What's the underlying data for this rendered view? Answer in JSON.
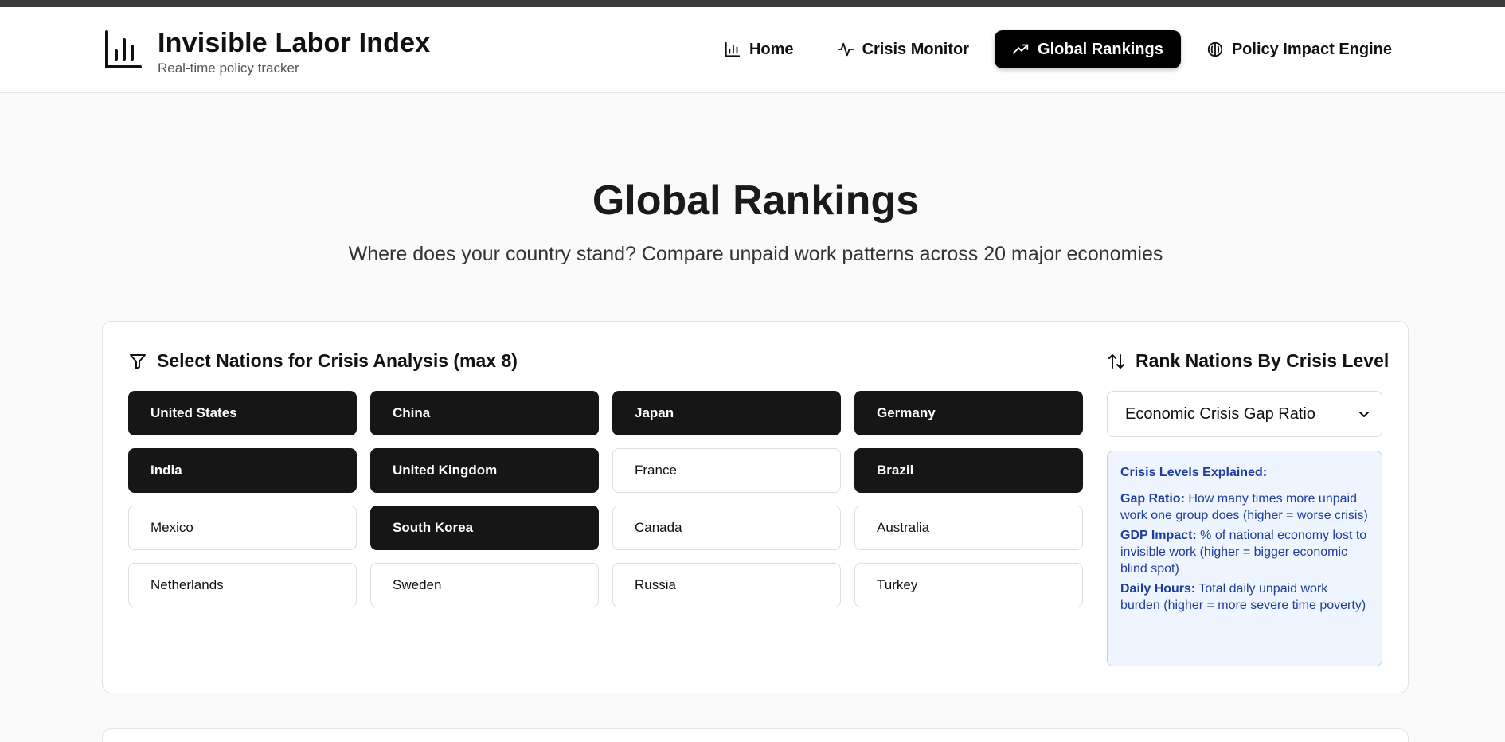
{
  "brand": {
    "title": "Invisible Labor Index",
    "subtitle": "Real-time policy tracker",
    "icon": "bar-chart-icon"
  },
  "nav": [
    {
      "label": "Home",
      "icon": "bar-chart-icon",
      "active": false
    },
    {
      "label": "Crisis Monitor",
      "icon": "activity-icon",
      "active": false
    },
    {
      "label": "Global Rankings",
      "icon": "trending-up-icon",
      "active": true
    },
    {
      "label": "Policy Impact Engine",
      "icon": "brain-icon",
      "active": false
    }
  ],
  "page": {
    "title": "Global Rankings",
    "subtitle": "Where does your country stand? Compare unpaid work patterns across 20 major economies"
  },
  "selection": {
    "heading": "Select Nations for Crisis Analysis (max 8)",
    "nations": [
      {
        "name": "United States",
        "selected": true
      },
      {
        "name": "China",
        "selected": true
      },
      {
        "name": "Japan",
        "selected": true
      },
      {
        "name": "Germany",
        "selected": true
      },
      {
        "name": "India",
        "selected": true
      },
      {
        "name": "United Kingdom",
        "selected": true
      },
      {
        "name": "France",
        "selected": false
      },
      {
        "name": "Brazil",
        "selected": true
      },
      {
        "name": "Mexico",
        "selected": false
      },
      {
        "name": "South Korea",
        "selected": true
      },
      {
        "name": "Canada",
        "selected": false
      },
      {
        "name": "Australia",
        "selected": false
      },
      {
        "name": "Netherlands",
        "selected": false
      },
      {
        "name": "Sweden",
        "selected": false
      },
      {
        "name": "Russia",
        "selected": false
      },
      {
        "name": "Turkey",
        "selected": false
      }
    ]
  },
  "ranking": {
    "heading": "Rank Nations By Crisis Level",
    "selected_option": "Economic Crisis Gap Ratio",
    "info": {
      "title": "Crisis Levels Explained:",
      "entries": [
        {
          "term": "Gap Ratio:",
          "text": " How many times more unpaid work one group does (higher = worse crisis)"
        },
        {
          "term": "GDP Impact:",
          "text": " % of national economy lost to invisible work (higher = bigger economic blind spot)"
        },
        {
          "term": "Daily Hours:",
          "text": " Total daily unpaid work burden (higher = more severe time poverty)"
        }
      ]
    }
  },
  "colors": {
    "accent": "#000000",
    "selected_chip": "#161616",
    "info_bg": "#eef5ff",
    "info_text": "#1f3d9c"
  }
}
